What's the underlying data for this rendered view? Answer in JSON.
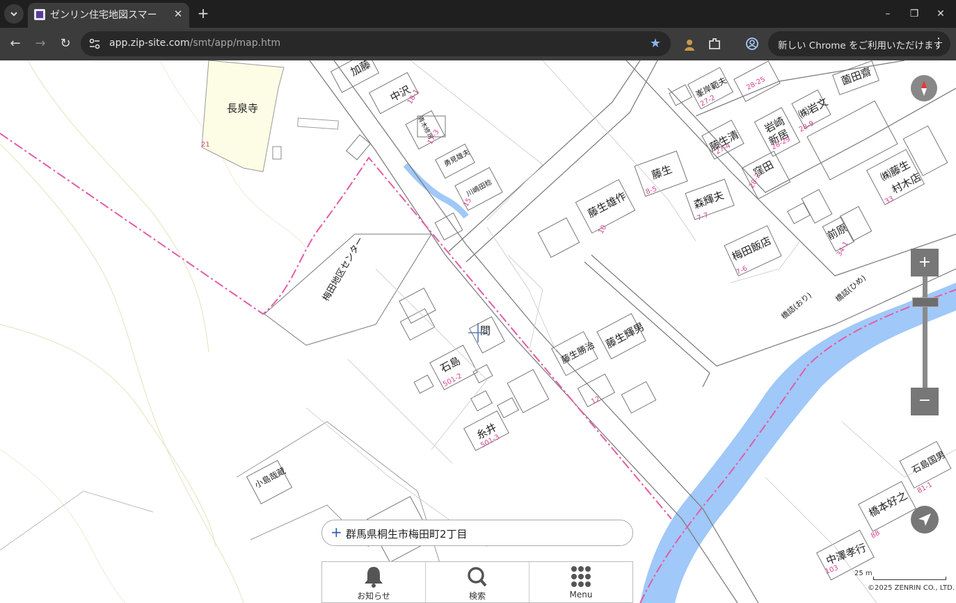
{
  "browser": {
    "tab_title": "ゼンリン住宅地図スマー",
    "url_host": "app.zip-site.com",
    "url_path": "/smt/app/map.htm",
    "update_text": "新しい Chrome をご利用いただけます"
  },
  "map": {
    "labels": {
      "chosenji": "長泉寺",
      "nakazawa": "中沢",
      "kato": "加藤",
      "fujiu": "藤生",
      "fujiu_yusaku": "藤生雄作",
      "mori": "森輝夫",
      "umeda_hanten": "梅田飯店",
      "fujiu_kiyoshi": "藤生清",
      "iwasaki": "岩崎",
      "arai": "新居",
      "iwabun": "㈱岩文",
      "kubota": "窪田",
      "zenhara": "前原",
      "kabu_fujiu": "㈱藤生",
      "muraki": "村木店",
      "sonoda": "薗田齋",
      "minegishi": "峯岸範夫",
      "ishijima": "石島",
      "itoi": "糸井",
      "fujiu_katsuharu": "藤生勝治",
      "fujiu_teruo": "藤生輝男",
      "kojima": "小島哉蔵",
      "hashimoto": "橋本好之",
      "ishijima_kunio": "石島国男",
      "nakazawa_takayuki": "中澤孝行",
      "aozaki": "青木修司",
      "yuji": "勇見雄夫",
      "kawashima": "川嶋田稔",
      "kaikan": "梅田地区センター",
      "ma": "間",
      "hashi1": "橋詰(おり)",
      "hashi2": "橋詰(ひめ)"
    },
    "parcels": {
      "p21": "21",
      "p17_3": "17-3",
      "p18_1": "18-1",
      "p15": "15",
      "p10": "10",
      "p8_5": "8-5",
      "p7_7": "7-7",
      "p7_6": "7-6",
      "p27_2": "27-2",
      "p28_25": "28-25",
      "p27_4": "27-4",
      "p28_29": "28-29",
      "p28_9": "28-9",
      "p28_2": "28-2",
      "p34_1": "34-1",
      "p33": "33",
      "p501_2": "501-2",
      "p501_3": "501-3",
      "p12": "12",
      "p103": "103",
      "p88": "88",
      "p81_1": "81-1"
    }
  },
  "controls": {
    "zoom_in": "+",
    "zoom_out": "−"
  },
  "address": {
    "text": "群馬県桐生市梅田町2丁目"
  },
  "menu": {
    "items": [
      "お知らせ",
      "検索",
      "Menu"
    ]
  },
  "scale": {
    "label": "25 m"
  },
  "copyright": "©2025 ZENRIN CO., LTD."
}
